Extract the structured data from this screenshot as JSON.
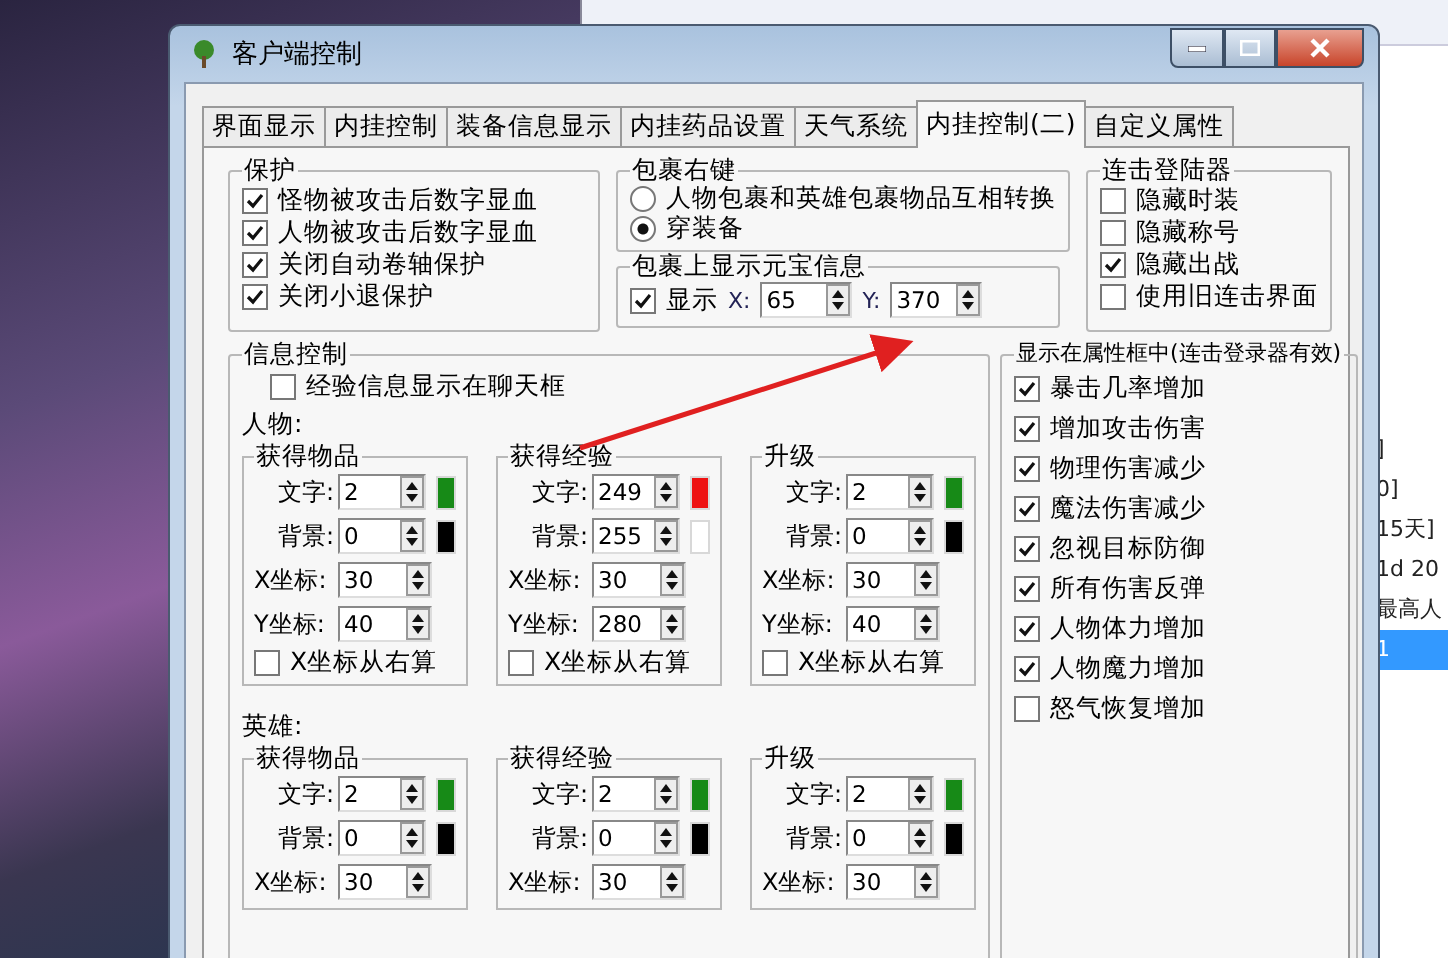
{
  "background_window": {
    "list_rows": [
      {
        "text": "]",
        "selected": false
      },
      {
        "text": "0]",
        "selected": false
      },
      {
        "text": "15天]",
        "selected": false
      },
      {
        "text": "1d 20",
        "selected": false
      },
      {
        "text": "最高人",
        "selected": false
      },
      {
        "text": "1",
        "selected": true
      }
    ]
  },
  "window": {
    "title": "客户端控制"
  },
  "tabs": [
    {
      "label": "界面显示",
      "selected": false
    },
    {
      "label": "内挂控制",
      "selected": false
    },
    {
      "label": "装备信息显示",
      "selected": false
    },
    {
      "label": "内挂药品设置",
      "selected": false
    },
    {
      "label": "天气系统",
      "selected": false
    },
    {
      "label": "内挂控制(二)",
      "selected": true
    },
    {
      "label": "自定义属性",
      "selected": false
    }
  ],
  "protect": {
    "title": "保护",
    "items": [
      {
        "label": "怪物被攻击后数字显血",
        "checked": true
      },
      {
        "label": "人物被攻击后数字显血",
        "checked": true
      },
      {
        "label": "关闭自动卷轴保护",
        "checked": true
      },
      {
        "label": "关闭小退保护",
        "checked": true
      }
    ]
  },
  "bag_right_click": {
    "title": "包裹右键",
    "options": [
      {
        "label": "人物包裹和英雄包裹物品互相转换",
        "selected": false
      },
      {
        "label": "穿装备",
        "selected": true
      }
    ]
  },
  "bag_ingot": {
    "title": "包裹上显示元宝信息",
    "show": {
      "label": "显示",
      "checked": true
    },
    "x_label": "X:",
    "x_value": "65",
    "y_label": "Y:",
    "y_value": "370"
  },
  "combo_launcher": {
    "title": "连击登陆器",
    "items": [
      {
        "label": "隐藏时装",
        "checked": false
      },
      {
        "label": "隐藏称号",
        "checked": false
      },
      {
        "label": "隐藏出战",
        "checked": true
      },
      {
        "label": "使用旧连击界面",
        "checked": false
      }
    ]
  },
  "info_control": {
    "title": "信息控制",
    "chat_option": {
      "label": "经验信息显示在聊天框",
      "checked": false
    },
    "sections": [
      {
        "title": "人物:",
        "groups": [
          {
            "title": "获得物品",
            "rows": [
              {
                "kind": "color",
                "label": "文字:",
                "value": "2",
                "color": "#178a17"
              },
              {
                "kind": "color",
                "label": "背景:",
                "value": "0",
                "color": "#000000"
              },
              {
                "kind": "plain",
                "label": "X坐标:",
                "value": "30"
              },
              {
                "kind": "plain",
                "label": "Y坐标:",
                "value": "40"
              }
            ],
            "right_align": {
              "label": "X坐标从右算",
              "checked": false
            }
          },
          {
            "title": "获得经验",
            "rows": [
              {
                "kind": "color",
                "label": "文字:",
                "value": "249",
                "color": "#ee1111"
              },
              {
                "kind": "color",
                "label": "背景:",
                "value": "255",
                "color": "#ffffff"
              },
              {
                "kind": "plain",
                "label": "X坐标:",
                "value": "30"
              },
              {
                "kind": "plain",
                "label": "Y坐标:",
                "value": "280"
              }
            ],
            "right_align": {
              "label": "X坐标从右算",
              "checked": false
            }
          },
          {
            "title": "升级",
            "rows": [
              {
                "kind": "color",
                "label": "文字:",
                "value": "2",
                "color": "#178a17"
              },
              {
                "kind": "color",
                "label": "背景:",
                "value": "0",
                "color": "#000000"
              },
              {
                "kind": "plain",
                "label": "X坐标:",
                "value": "30"
              },
              {
                "kind": "plain",
                "label": "Y坐标:",
                "value": "40"
              }
            ],
            "right_align": {
              "label": "X坐标从右算",
              "checked": false
            }
          }
        ]
      },
      {
        "title": "英雄:",
        "groups": [
          {
            "title": "获得物品",
            "rows": [
              {
                "kind": "color",
                "label": "文字:",
                "value": "2",
                "color": "#178a17"
              },
              {
                "kind": "color",
                "label": "背景:",
                "value": "0",
                "color": "#000000"
              },
              {
                "kind": "plain",
                "label": "X坐标:",
                "value": "30"
              }
            ]
          },
          {
            "title": "获得经验",
            "rows": [
              {
                "kind": "color",
                "label": "文字:",
                "value": "2",
                "color": "#178a17"
              },
              {
                "kind": "color",
                "label": "背景:",
                "value": "0",
                "color": "#000000"
              },
              {
                "kind": "plain",
                "label": "X坐标:",
                "value": "30"
              }
            ]
          },
          {
            "title": "升级",
            "rows": [
              {
                "kind": "color",
                "label": "文字:",
                "value": "2",
                "color": "#178a17"
              },
              {
                "kind": "color",
                "label": "背景:",
                "value": "0",
                "color": "#000000"
              },
              {
                "kind": "plain",
                "label": "X坐标:",
                "value": "30"
              }
            ]
          }
        ]
      }
    ]
  },
  "attributes": {
    "title": "显示在属性框中(连击登录器有效)",
    "items": [
      {
        "label": "暴击几率增加",
        "checked": true
      },
      {
        "label": "增加攻击伤害",
        "checked": true
      },
      {
        "label": "物理伤害减少",
        "checked": true
      },
      {
        "label": "魔法伤害减少",
        "checked": true
      },
      {
        "label": "忽视目标防御",
        "checked": true
      },
      {
        "label": "所有伤害反弹",
        "checked": true
      },
      {
        "label": "人物体力增加",
        "checked": true
      },
      {
        "label": "人物魔力增加",
        "checked": true
      },
      {
        "label": "怒气恢复增加",
        "checked": false
      }
    ]
  }
}
